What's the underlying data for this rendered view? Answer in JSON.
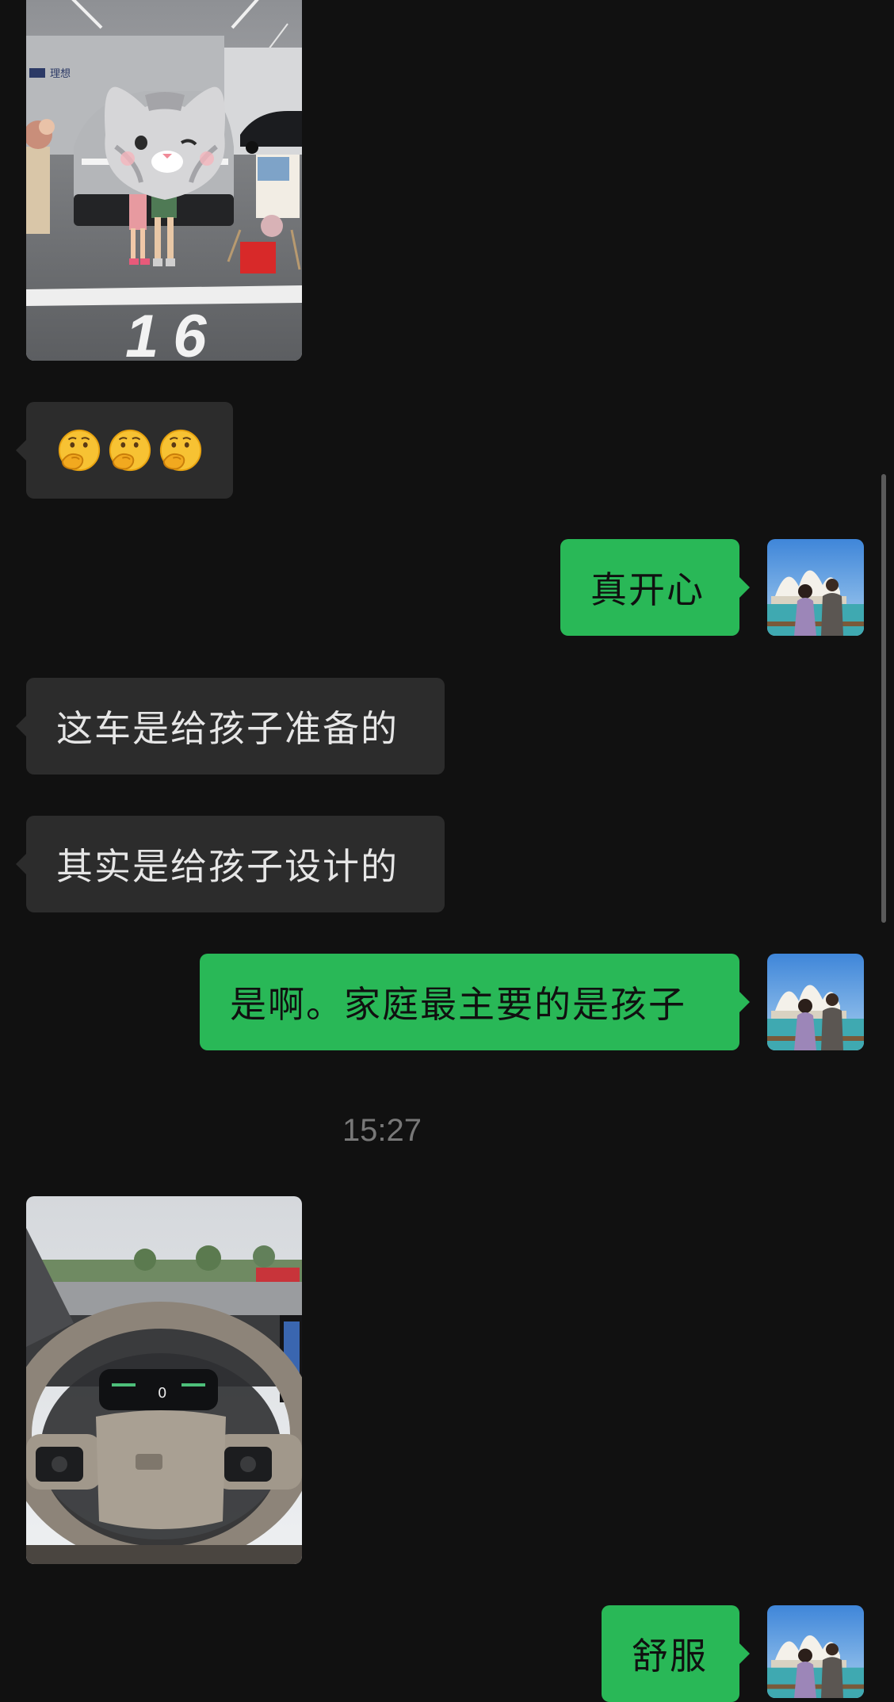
{
  "messages": {
    "emoji_reaction": {
      "icon": "shushing-face-emoji",
      "count": 3
    },
    "msg_happy": "真开心",
    "msg_car_for_kids": "这车是给孩子准备的",
    "msg_designed_for_kids": "其实是给孩子设计的",
    "msg_family_kids": "是啊。家庭最主要的是孩子",
    "msg_comfortable": "舒服"
  },
  "timestamp": "15:27",
  "photos": {
    "showroom": {
      "badge_text": "理想",
      "parking_number": "16"
    },
    "steering": {
      "speed_readout": "0"
    }
  },
  "colors": {
    "background": "#111111",
    "incoming_bubble": "#2c2c2c",
    "outgoing_bubble": "#29b857",
    "timestamp_text": "#787878"
  }
}
